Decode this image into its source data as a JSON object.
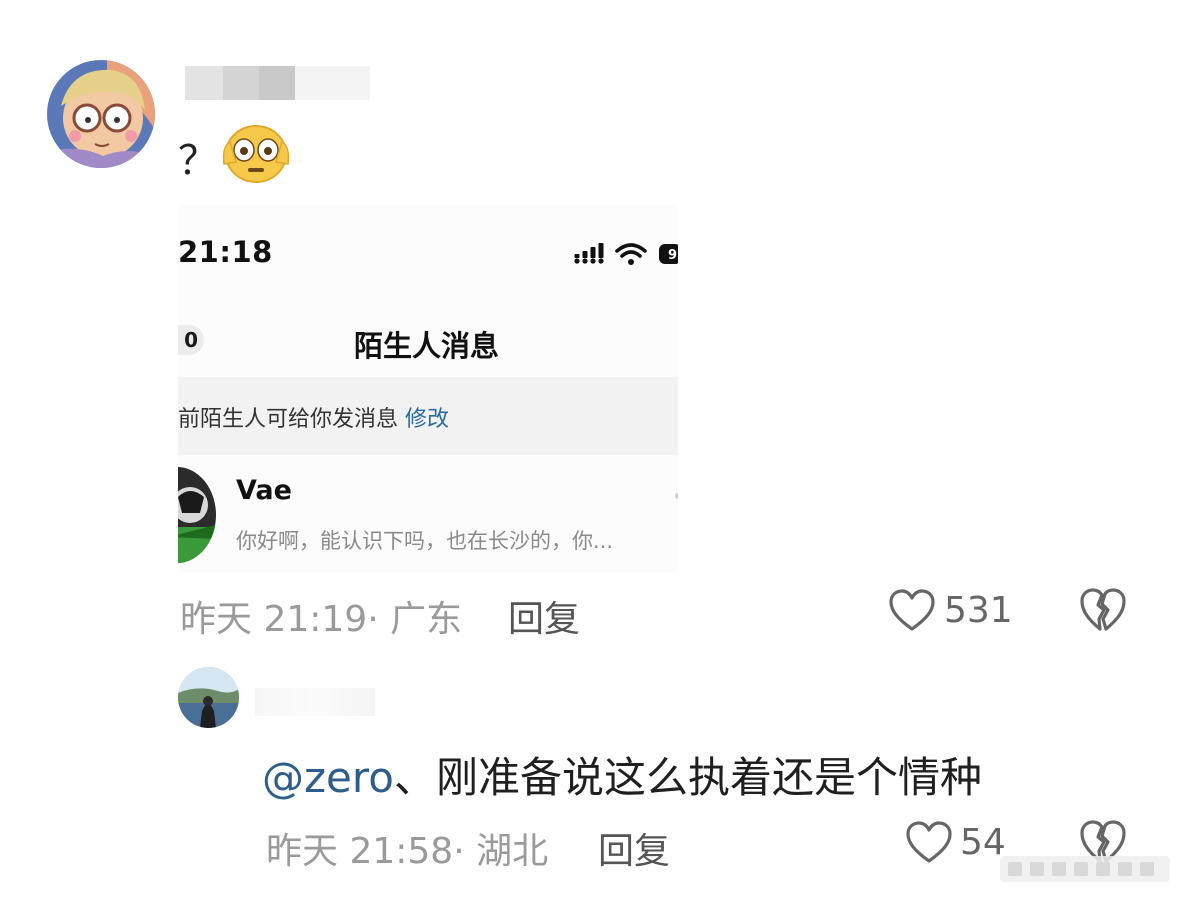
{
  "comment1": {
    "text": "？",
    "time_location": "昨天 21:19· 广东",
    "reply_label": "回复",
    "likes": "531",
    "screenshot": {
      "status_time": "21:18",
      "back_count": "0",
      "title": "陌生人消息",
      "banner_text": "前陌生人可给你发消息",
      "banner_link": "修改",
      "sender_name": "Vae",
      "sender_message": "你好啊，能认识下吗，也在长沙的，你..."
    }
  },
  "comment2": {
    "mention": "@zero",
    "text": "、刚准备说这么执着还是个情种",
    "time_location": "昨天 21:58· 湖北",
    "reply_label": "回复",
    "likes": "54"
  },
  "icons": {
    "like": "heart-icon",
    "dislike": "broken-heart-icon",
    "emoji": "flushed-face-icon"
  },
  "colors": {
    "mention": "#2d5d8a",
    "banner_link": "#2a6aa8",
    "meta_gray": "#9a9a9a"
  }
}
